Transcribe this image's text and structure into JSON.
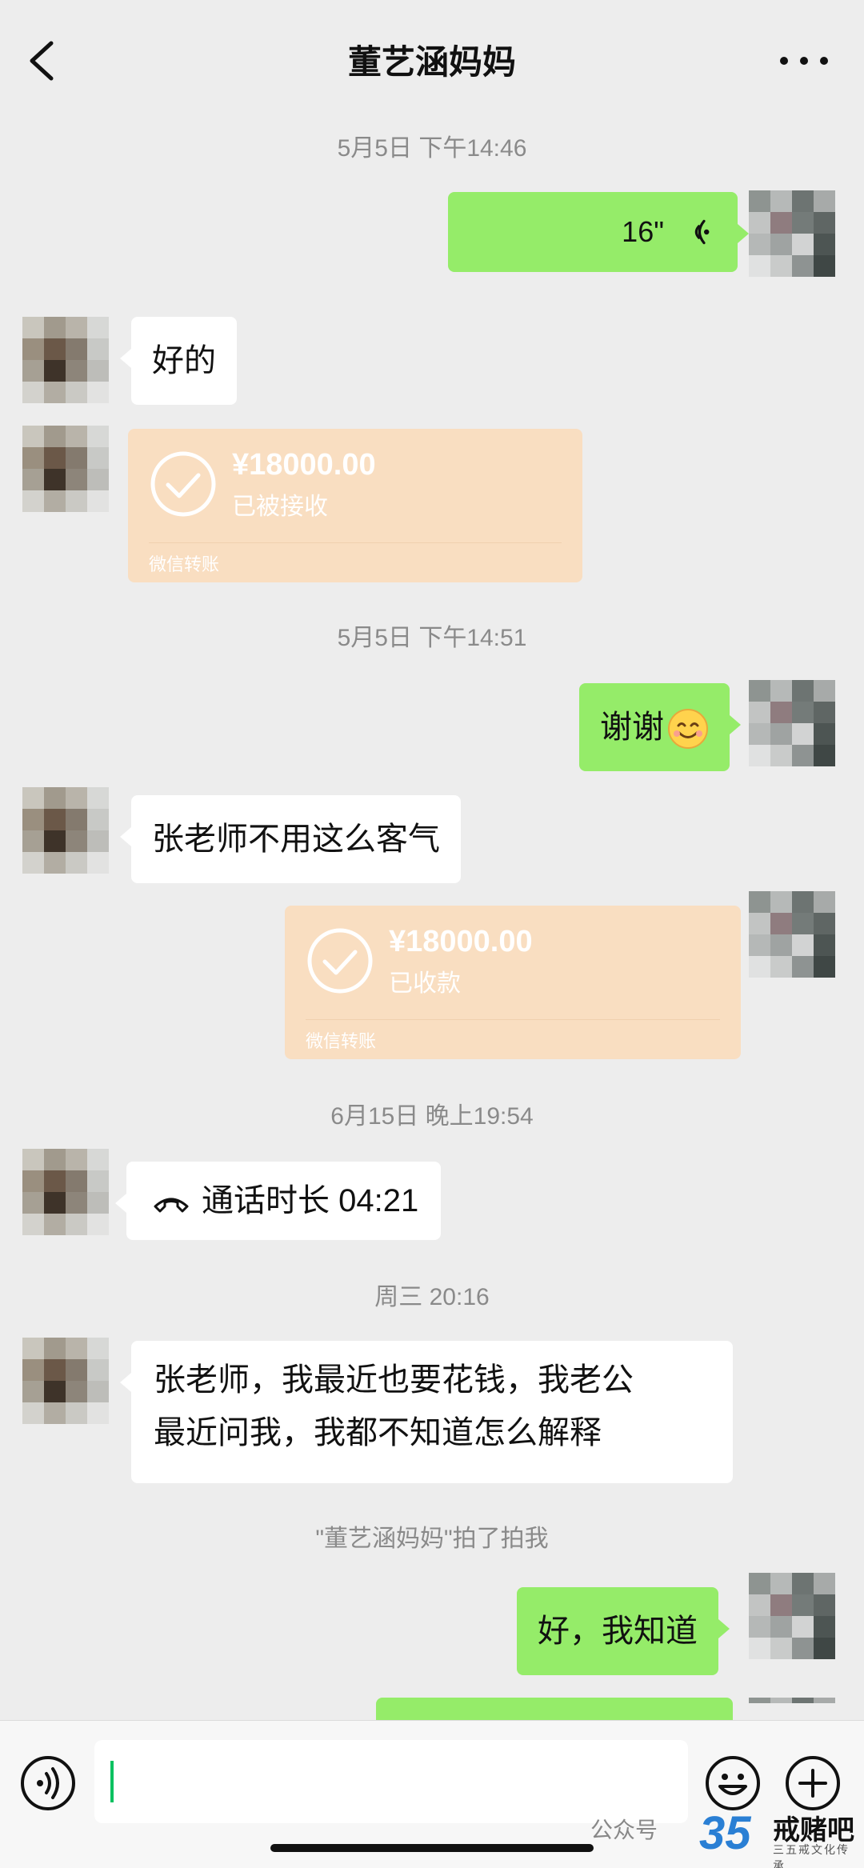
{
  "header": {
    "title": "董艺涵妈妈"
  },
  "messages": {
    "ts1": "5月5日 下午14:46",
    "voice_duration": "16\"",
    "m_ok": "好的",
    "transfer1": {
      "amount": "¥18000.00",
      "status": "已被接收",
      "footer": "微信转账"
    },
    "ts2": "5月5日 下午14:51",
    "m_thanks": "谢谢",
    "m_polite": "张老师不用这么客气",
    "transfer2": {
      "amount": "¥18000.00",
      "status": "已收款",
      "footer": "微信转账"
    },
    "ts3": "6月15日 晚上19:54",
    "call_duration": "通话时长 04:21",
    "ts4": "周三 20:16",
    "m_long_line1": "张老师，我最近也要花钱，我老公",
    "m_long_line2": "最近问我，我都不知道怎么解释",
    "pat_notice": "\"董艺涵妈妈\"拍了拍我",
    "m_know": "好，我知道"
  },
  "watermark": {
    "text": "公众号",
    "logo_number": "35",
    "logo_brand": "戒赌吧",
    "logo_sub": "三五戒文化传承"
  },
  "icons": {
    "back": "chevron-left-icon",
    "more": "more-dots-icon",
    "voice": "voice-input-icon",
    "emoji": "emoji-icon",
    "plus": "plus-circle-icon",
    "check": "check-circle-icon",
    "call": "phone-hangup-icon",
    "smile": "smile-emoji-icon"
  },
  "colors": {
    "bg": "#ededed",
    "green_bubble": "#95ec69",
    "white_bubble": "#ffffff",
    "transfer": "#f9dec1",
    "caret": "#07c160"
  }
}
